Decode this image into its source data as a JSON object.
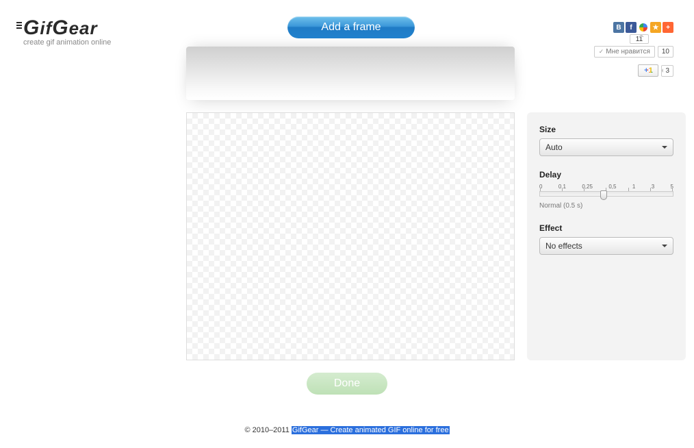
{
  "logo": {
    "text": "GifGear",
    "tagline": "create gif animation online"
  },
  "header": {
    "add_frame": "Add a frame"
  },
  "social": {
    "counter_top": "11",
    "like_label": "Мне нравится",
    "like_count": "10",
    "plusone": "+1",
    "plusone_count": "3"
  },
  "sidebar": {
    "size": {
      "label": "Size",
      "value": "Auto"
    },
    "delay": {
      "label": "Delay",
      "ticks": [
        "0",
        "0,1",
        "0,25",
        "0,5",
        "1",
        "3",
        "5"
      ],
      "status": "Normal (0.5 s)"
    },
    "effect": {
      "label": "Effect",
      "value": "No effects"
    }
  },
  "actions": {
    "done": "Done"
  },
  "footer": {
    "copyright": "© 2010–2011 ",
    "link": "GifGear — Create animated GIF online for free"
  }
}
